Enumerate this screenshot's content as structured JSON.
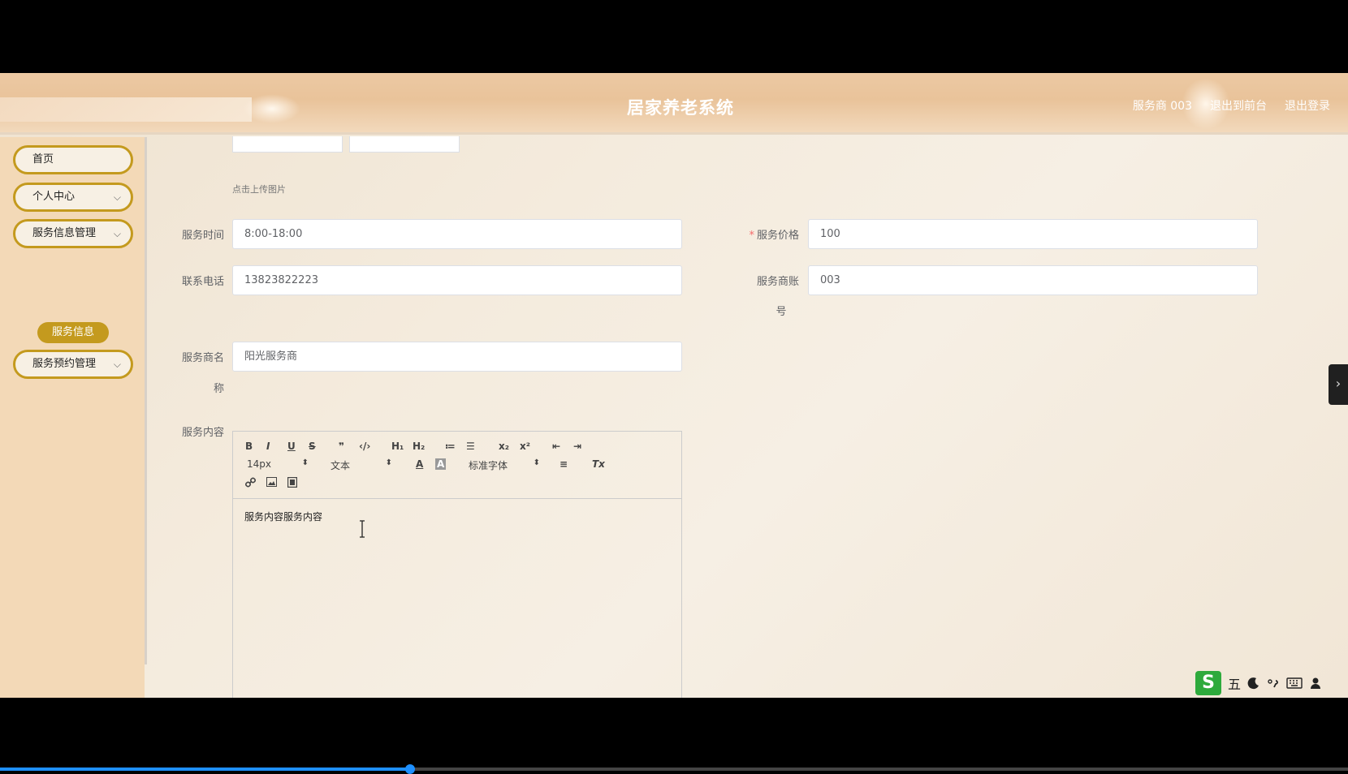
{
  "header": {
    "title": "居家养老系统",
    "user": "服务商 003",
    "back_to_front": "退出到前台",
    "logout": "退出登录"
  },
  "sidebar": {
    "items": [
      {
        "label": "首页",
        "has_children": false
      },
      {
        "label": "个人中心",
        "has_children": true
      },
      {
        "label": "服务信息管理",
        "has_children": true
      },
      {
        "label": "服务预约管理",
        "has_children": true
      }
    ],
    "active_sub": "服务信息",
    "chevron": "⌵"
  },
  "form": {
    "upload_hint": "点击上传图片",
    "service_time": {
      "label": "服务时间",
      "value": "8:00-18:00"
    },
    "service_price": {
      "label": "服务价格",
      "value": "100",
      "required": true
    },
    "phone": {
      "label": "联系电话",
      "value": "13823822223"
    },
    "provider_account": {
      "label_a": "服务商账",
      "label_b": "号",
      "value": "003"
    },
    "provider_name": {
      "label_a": "服务商名",
      "label_b": "称",
      "value": "阳光服务商"
    },
    "service_content": {
      "label": "服务内容",
      "value": "服务内容服务内容"
    }
  },
  "editor": {
    "toolbar_row1": [
      "B",
      "I",
      "U",
      "S",
      "❞",
      "‹/›",
      "H₁",
      "H₂",
      "≔",
      "☰",
      "x₂",
      "x²",
      "⇤",
      "⇥"
    ],
    "font_size": "14px",
    "header_select": "文本",
    "font_family": "标准字体",
    "color_icon": "A",
    "bg_icon": "A",
    "align_icon": "≡",
    "clear_icon": "Tx",
    "select_arrow": "⬍",
    "row3_icons": [
      "link-icon",
      "image-icon",
      "video-icon"
    ]
  },
  "ime": {
    "logo": "S",
    "mode": "五",
    "icons": [
      "moon-icon",
      "punct-icon",
      "keyboard-icon",
      "user-icon"
    ]
  },
  "playback": {
    "progress_fraction": 0.304
  },
  "colors": {
    "accent": "#c49a1e",
    "sidebar_bg": "#f3d9b7",
    "header": "#e9c39a"
  }
}
